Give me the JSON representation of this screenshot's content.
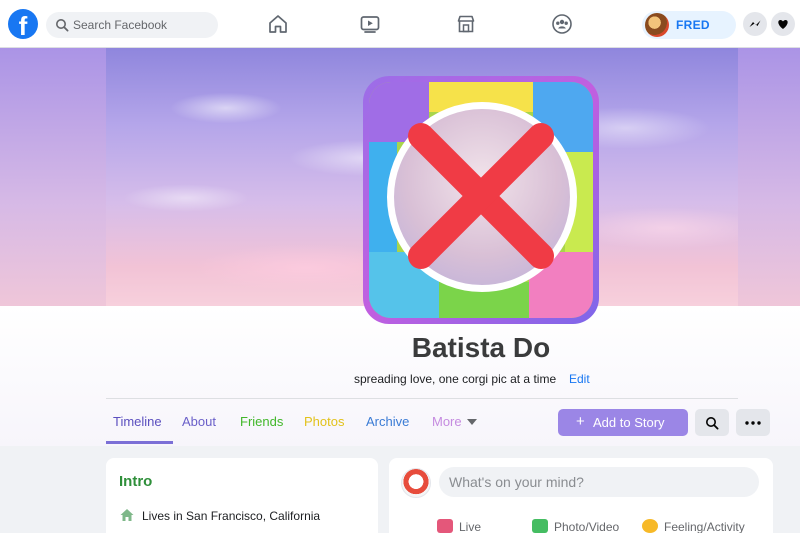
{
  "topbar": {
    "logo_letter": "f",
    "search_placeholder": "Search Facebook",
    "nav_icons": [
      "home-icon",
      "watch-icon",
      "marketplace-icon",
      "groups-icon"
    ],
    "user_name": "FRED",
    "action_icons": [
      "messenger-icon",
      "notifications-icon"
    ],
    "brand_color": "#1877f2"
  },
  "profile": {
    "name": "Batista Do",
    "bio": "spreading love, one corgi pic at a time",
    "edit_label": "Edit"
  },
  "tabs": [
    {
      "label": "Timeline",
      "color": "#5b4fbf",
      "active": true
    },
    {
      "label": "About",
      "color": "#6a5fc9"
    },
    {
      "label": "Friends",
      "color": "#42b72a"
    },
    {
      "label": "Photos",
      "color": "#e2c21b"
    },
    {
      "label": "Archive",
      "color": "#3a7bd5"
    },
    {
      "label": "More",
      "color": "#c58be0"
    }
  ],
  "actions": {
    "add_story_label": "Add to Story",
    "add_story_icon": "+",
    "search_icon": "search-icon",
    "more_icon": "ellipsis-icon"
  },
  "intro": {
    "title": "Intro",
    "location": "Lives in San Francisco, California"
  },
  "composer": {
    "placeholder": "What's on your mind?",
    "actions": [
      {
        "label": "Live",
        "color": "#e4577a"
      },
      {
        "label": "Photo/Video",
        "color": "#45bd62"
      },
      {
        "label": "Feeling/Activity",
        "color": "#f7b928"
      }
    ]
  }
}
